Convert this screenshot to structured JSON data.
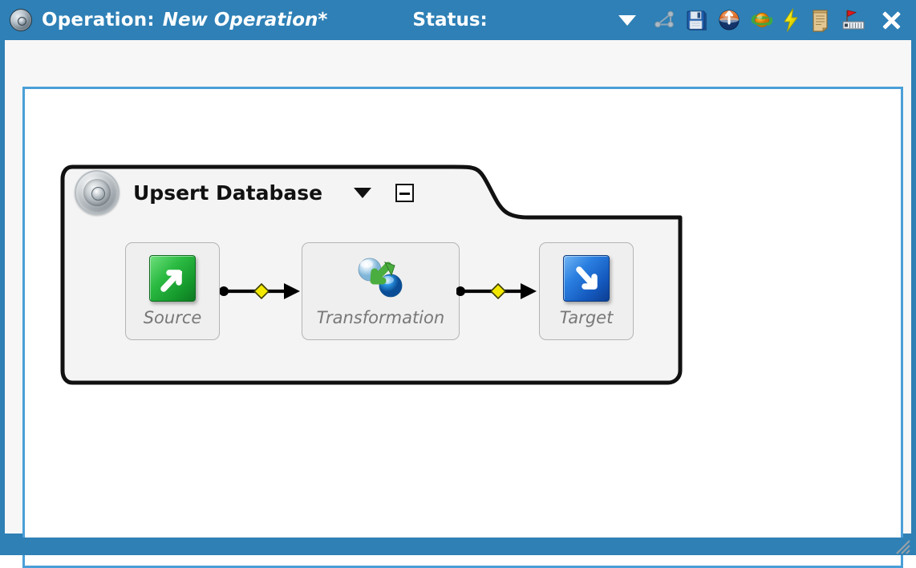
{
  "titlebar": {
    "app_icon": "disc-icon",
    "operation_label": "Operation:",
    "operation_name": "New Operation*",
    "status_label": "Status:",
    "status_caret": "caret-down-icon",
    "actions": [
      {
        "name": "share-graph-icon",
        "tooltip": "Graph"
      },
      {
        "name": "save-icon",
        "tooltip": "Save"
      },
      {
        "name": "deploy-icon",
        "tooltip": "Deploy"
      },
      {
        "name": "refresh-planet-icon",
        "tooltip": "Refresh"
      },
      {
        "name": "run-lightning-icon",
        "tooltip": "Run"
      },
      {
        "name": "log-scroll-icon",
        "tooltip": "Log"
      },
      {
        "name": "milestone-flag-icon",
        "tooltip": "Milestone"
      },
      {
        "name": "close-icon",
        "tooltip": "Close"
      }
    ],
    "background_color": "#2e80b6",
    "text_color": "#ffffff"
  },
  "canvas": {
    "border_color": "#4a9fd8",
    "background_color": "#ffffff"
  },
  "operation_block": {
    "icon": "gear-icon",
    "title": "Upsert Database",
    "menu_caret": "caret-down-icon",
    "collapse_label": "collapse-icon",
    "border_color": "#111111",
    "fill_color": "#f4f4f4",
    "nodes": [
      {
        "id": "source",
        "label": "Source",
        "icon": "green-arrow-out-icon"
      },
      {
        "id": "transformation",
        "label": "Transformation",
        "icon": "transform-spheres-icon"
      },
      {
        "id": "target",
        "label": "Target",
        "icon": "blue-arrow-in-icon"
      }
    ],
    "connectors": [
      {
        "from": "source",
        "to": "transformation",
        "marker_color": "#f2e800"
      },
      {
        "from": "transformation",
        "to": "target",
        "marker_color": "#f2e800"
      }
    ]
  },
  "statusbar": {
    "resize_grip": "resize-grip-icon"
  }
}
